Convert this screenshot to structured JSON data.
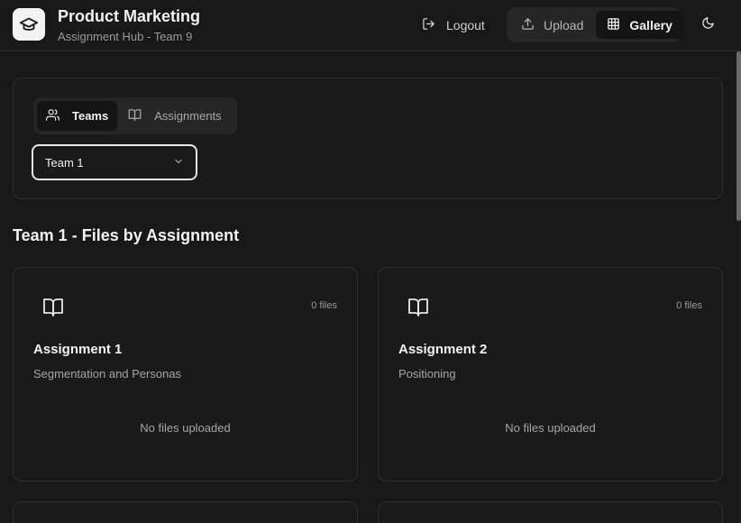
{
  "header": {
    "title": "Product Marketing",
    "subtitle": "Assignment Hub - Team 9",
    "logout_label": "Logout",
    "upload_label": "Upload",
    "gallery_label": "Gallery"
  },
  "filters": {
    "tabs": [
      {
        "label": "Teams",
        "active": true
      },
      {
        "label": "Assignments",
        "active": false
      }
    ],
    "team_select_value": "Team 1"
  },
  "section": {
    "title": "Team 1 - Files by Assignment"
  },
  "assignments": [
    {
      "title": "Assignment 1",
      "description": "Segmentation and Personas",
      "file_count": "0 files",
      "empty_text": "No files uploaded"
    },
    {
      "title": "Assignment 2",
      "description": "Positioning",
      "file_count": "0 files",
      "empty_text": "No files uploaded"
    }
  ],
  "colors": {
    "background": "#181818",
    "card": "#1a1a1a",
    "border": "#2f2f2f",
    "text": "#f2f2f2",
    "muted": "#a5a5a5"
  }
}
